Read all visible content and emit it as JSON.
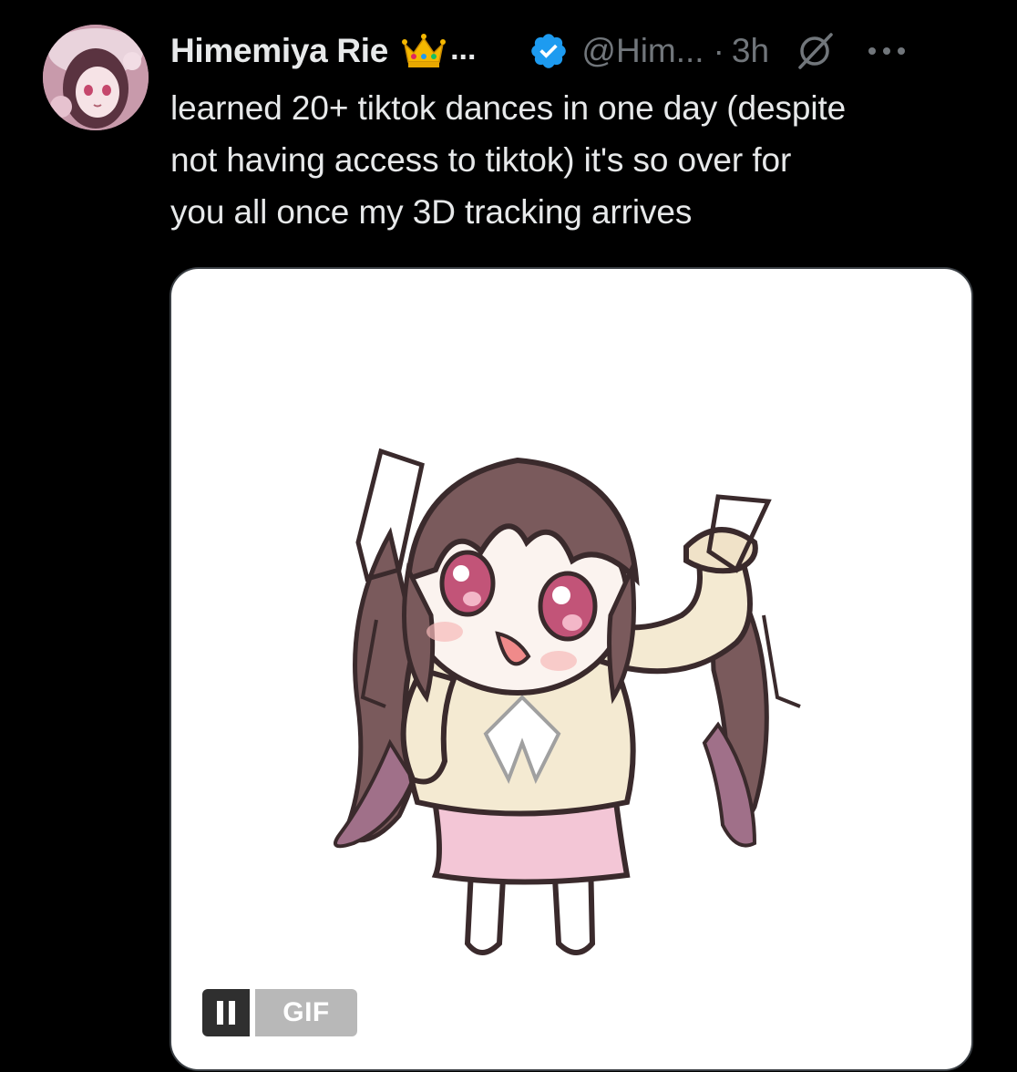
{
  "tweet": {
    "author": {
      "display_name": "Himemiya Rie",
      "name_badge_icon": "crown-emoji",
      "name_truncation": "...",
      "verified_icon": "verified-badge-icon",
      "handle": "@Him...",
      "separator": "·",
      "time": "3h"
    },
    "actions": {
      "grok_icon": "grok-icon",
      "more_icon": "more-icon"
    },
    "text": "learned 20+ tiktok dances in one day (despite\nnot having access to tiktok) it's so over for\nyou all once my 3D tracking arrives",
    "media": {
      "type": "gif",
      "pause_icon": "pause-icon",
      "badge_label": "GIF"
    }
  },
  "colors": {
    "background": "#000000",
    "text_primary": "#e7e9ea",
    "text_secondary": "#71767b",
    "verified_blue": "#1d9bf0",
    "media_border": "#3a3f44"
  }
}
